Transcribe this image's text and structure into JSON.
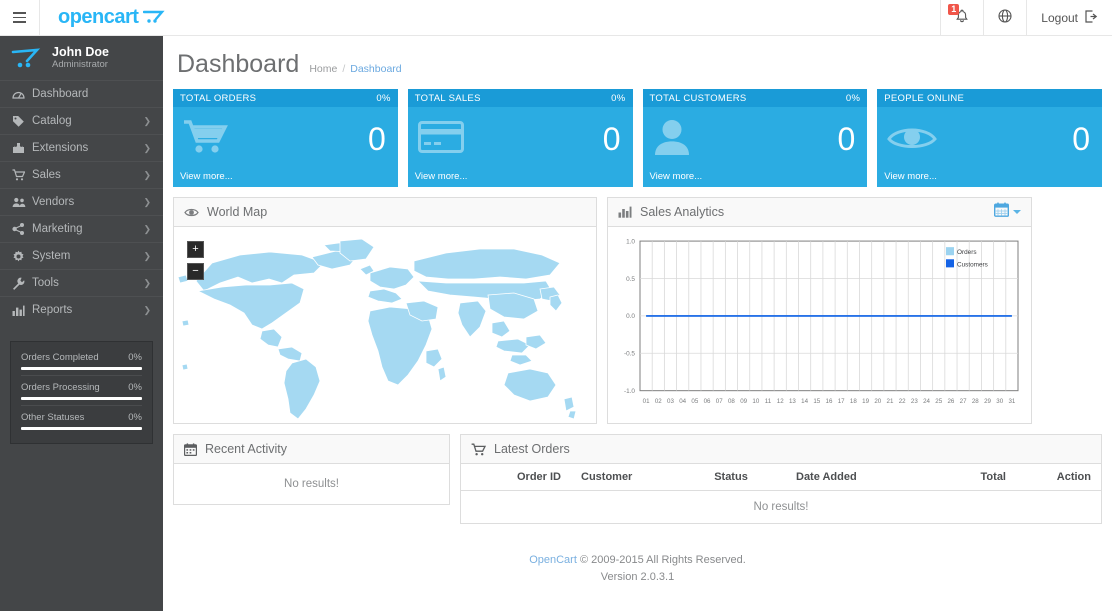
{
  "header": {
    "brand": "opencart",
    "nav_toggle_icon": "hamburger-icon",
    "notification_icon": "bell-icon",
    "notification_count": "1",
    "store_front_icon": "globe-icon",
    "logout_label": "Logout",
    "logout_icon": "sign-out-icon"
  },
  "sidebar": {
    "profile": {
      "name": "John Doe",
      "role": "Administrator",
      "avatar_icon": "opencart-cart-logo"
    },
    "items": [
      {
        "label": "Dashboard",
        "icon": "dashboard-icon",
        "has_caret": false
      },
      {
        "label": "Catalog",
        "icon": "tag-icon",
        "has_caret": true
      },
      {
        "label": "Extensions",
        "icon": "puzzle-icon",
        "has_caret": true
      },
      {
        "label": "Sales",
        "icon": "cart-icon",
        "has_caret": true
      },
      {
        "label": "Vendors",
        "icon": "users-icon",
        "has_caret": true
      },
      {
        "label": "Marketing",
        "icon": "share-icon",
        "has_caret": true
      },
      {
        "label": "System",
        "icon": "gear-icon",
        "has_caret": true
      },
      {
        "label": "Tools",
        "icon": "wrench-icon",
        "has_caret": true
      },
      {
        "label": "Reports",
        "icon": "bar-chart-icon",
        "has_caret": true
      }
    ],
    "stats": [
      {
        "label": "Orders Completed",
        "percent": "0%",
        "value": 0
      },
      {
        "label": "Orders Processing",
        "percent": "0%",
        "value": 0
      },
      {
        "label": "Other Statuses",
        "percent": "0%",
        "value": 0
      }
    ]
  },
  "page": {
    "title": "Dashboard",
    "breadcrumb": [
      {
        "label": "Home",
        "active": false
      },
      {
        "label": "Dashboard",
        "active": true
      }
    ],
    "breadcrumb_separator": "/"
  },
  "tiles": [
    {
      "title": "TOTAL ORDERS",
      "percent": "0%",
      "value": "0",
      "footer": "View more...",
      "icon": "shopping-cart-icon"
    },
    {
      "title": "TOTAL SALES",
      "percent": "0%",
      "value": "0",
      "footer": "View more...",
      "icon": "credit-card-icon"
    },
    {
      "title": "TOTAL CUSTOMERS",
      "percent": "0%",
      "value": "0",
      "footer": "View more...",
      "icon": "user-icon"
    },
    {
      "title": "PEOPLE ONLINE",
      "percent": "",
      "value": "0",
      "footer": "View more...",
      "icon": "eye-icon"
    }
  ],
  "map_panel": {
    "title": "World Map",
    "icon": "eye-icon",
    "zoom_in_label": "+",
    "zoom_out_label": "−",
    "land_color": "#a5d9f2"
  },
  "chart_panel": {
    "title": "Sales Analytics",
    "icon": "bar-chart-icon",
    "calendar_icon": "calendar-icon",
    "caret_icon": "chevron-down-icon"
  },
  "chart_data": {
    "type": "line",
    "title": "Sales Analytics",
    "xlabel": "",
    "ylabel": "",
    "ylim": [
      -1.0,
      1.0
    ],
    "yticks": [
      "1.0",
      "0.5",
      "0.0",
      "-0.5",
      "-1.0"
    ],
    "ytick_values": [
      1.0,
      0.5,
      0.0,
      -0.5,
      -1.0
    ],
    "categories": [
      "01",
      "02",
      "03",
      "04",
      "05",
      "06",
      "07",
      "08",
      "09",
      "10",
      "11",
      "12",
      "13",
      "14",
      "15",
      "16",
      "17",
      "18",
      "19",
      "20",
      "21",
      "22",
      "23",
      "24",
      "25",
      "26",
      "27",
      "28",
      "29",
      "30",
      "31"
    ],
    "series": [
      {
        "name": "Orders",
        "color": "#9bd3f0",
        "values": [
          0,
          0,
          0,
          0,
          0,
          0,
          0,
          0,
          0,
          0,
          0,
          0,
          0,
          0,
          0,
          0,
          0,
          0,
          0,
          0,
          0,
          0,
          0,
          0,
          0,
          0,
          0,
          0,
          0,
          0,
          0
        ]
      },
      {
        "name": "Customers",
        "color": "#1463e6",
        "values": [
          0,
          0,
          0,
          0,
          0,
          0,
          0,
          0,
          0,
          0,
          0,
          0,
          0,
          0,
          0,
          0,
          0,
          0,
          0,
          0,
          0,
          0,
          0,
          0,
          0,
          0,
          0,
          0,
          0,
          0,
          0
        ]
      }
    ],
    "grid": true,
    "legend_position": "top-right"
  },
  "activity_panel": {
    "title": "Recent Activity",
    "icon": "calendar-icon",
    "empty_text": "No results!"
  },
  "orders_panel": {
    "title": "Latest Orders",
    "icon": "cart-icon",
    "columns": [
      "Order ID",
      "Customer",
      "Status",
      "Date Added",
      "Total",
      "Action"
    ],
    "rows": [],
    "empty_text": "No results!"
  },
  "footer": {
    "link_label": "OpenCart",
    "copyright": " © 2009-2015 All Rights Reserved.",
    "version": "Version 2.0.3.1"
  },
  "colors": {
    "brand_blue": "#29b6f6",
    "tile_blue": "#2bace2",
    "tile_head_blue": "#1a9bd7",
    "sidebar_dark": "#444648",
    "badge_red": "#f0564a"
  }
}
